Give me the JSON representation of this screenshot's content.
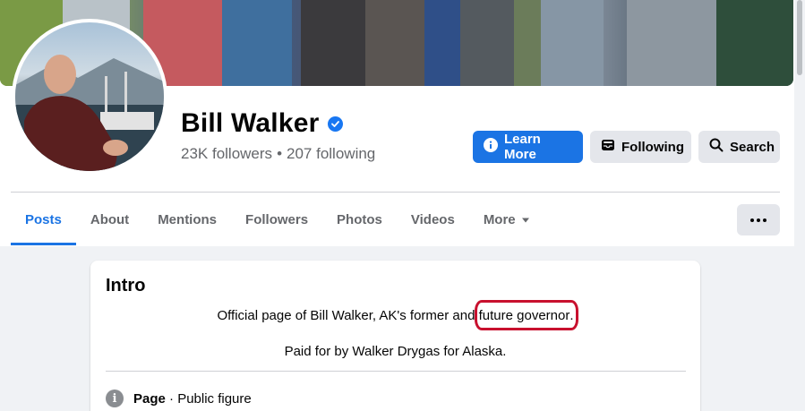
{
  "profile": {
    "name": "Bill Walker",
    "followers": "23K followers",
    "separator": "•",
    "following": "207 following"
  },
  "actions": {
    "learn_more": "Learn More",
    "following": "Following",
    "search": "Search"
  },
  "tabs": [
    {
      "label": "Posts"
    },
    {
      "label": "About"
    },
    {
      "label": "Mentions"
    },
    {
      "label": "Followers"
    },
    {
      "label": "Photos"
    },
    {
      "label": "Videos"
    },
    {
      "label": "More"
    }
  ],
  "intro": {
    "title": "Intro",
    "bio_before": "Official page of Bill Walker, AK's former and ",
    "bio_highlight": "future governor",
    "bio_after": ".",
    "paid_for": "Paid for by Walker Drygas for Alaska.",
    "category_label": "Page",
    "category_value": " · Public figure"
  },
  "colors": {
    "accent": "#1b74e4",
    "annotation": "#c8102e"
  },
  "icons": {
    "verified": "verified-badge-icon",
    "learn_more": "info-circle-icon",
    "following": "inbox-check-icon",
    "search": "search-icon",
    "more": "caret-down-icon",
    "menu": "ellipsis-icon",
    "category": "info-icon"
  }
}
